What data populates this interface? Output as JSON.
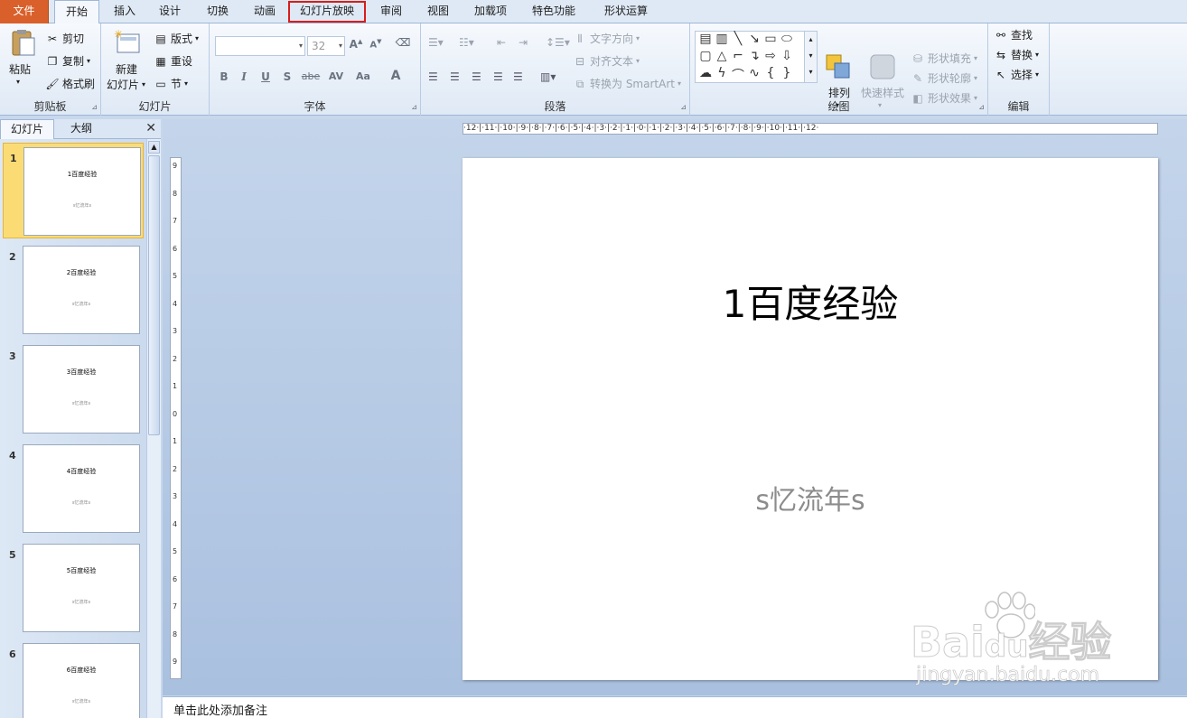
{
  "tabs": [
    {
      "label": "文件"
    },
    {
      "label": "开始"
    },
    {
      "label": "插入"
    },
    {
      "label": "设计"
    },
    {
      "label": "切换"
    },
    {
      "label": "动画"
    },
    {
      "label": "幻灯片放映"
    },
    {
      "label": "审阅"
    },
    {
      "label": "视图"
    },
    {
      "label": "加载项"
    },
    {
      "label": "特色功能"
    },
    {
      "label": "形状运算"
    }
  ],
  "clipboard": {
    "title": "剪贴板",
    "paste": "粘贴",
    "cut": "剪切",
    "copy": "复制",
    "format_painter": "格式刷"
  },
  "slides_group": {
    "title": "幻灯片",
    "new_slide_1": "新建",
    "new_slide_2": "幻灯片",
    "layout": "版式",
    "reset": "重设",
    "section": "节"
  },
  "font": {
    "title": "字体",
    "font_name": "",
    "font_size": "32",
    "bold": "B",
    "italic": "I",
    "underline": "U",
    "shadow": "S",
    "strike": "abe",
    "spacing": "AV",
    "case": "Aa",
    "color": "A"
  },
  "paragraph": {
    "title": "段落",
    "text_direction": "文字方向",
    "align_text": "对齐文本",
    "smartart": "转换为 SmartArt"
  },
  "drawing": {
    "title": "绘图",
    "arrange": "排列",
    "quick_styles": "快速样式",
    "shape_fill": "形状填充",
    "shape_outline": "形状轮廓",
    "shape_effects": "形状效果"
  },
  "editing": {
    "title": "编辑",
    "find": "查找",
    "replace": "替换",
    "select": "选择"
  },
  "left_pane": {
    "tab_slides": "幻灯片",
    "tab_outline": "大纲"
  },
  "thumbnails": [
    {
      "num": "1",
      "title": "1百度经验",
      "sub": "s忆流年s"
    },
    {
      "num": "2",
      "title": "2百度经验",
      "sub": "s忆流年s"
    },
    {
      "num": "3",
      "title": "3百度经验",
      "sub": "s忆流年s"
    },
    {
      "num": "4",
      "title": "4百度经验",
      "sub": "s忆流年s"
    },
    {
      "num": "5",
      "title": "5百度经验",
      "sub": "s忆流年s"
    },
    {
      "num": "6",
      "title": "6百度经验",
      "sub": "s忆流年s"
    }
  ],
  "ruler_h": "·12·|·11·|·10·|·9·|·8·|·7·|·6·|·5·|·4·|·3·|·2·|·1·|·0·|·1·|·2·|·3·|·4·|·5·|·6·|·7·|·8·|·9·|·10·|·11·|·12·",
  "slide": {
    "title": "1百度经验",
    "subtitle": "s忆流年s"
  },
  "watermark": {
    "brand": "Bai",
    "brand2": "du",
    "brand3": "经验",
    "url": "jingyan.baidu.com"
  },
  "notes_placeholder": "单击此处添加备注",
  "colors": {
    "file_tab": "#d9602b",
    "highlight_box": "#d91c1c",
    "selected_thumb": "#fbdc74"
  }
}
